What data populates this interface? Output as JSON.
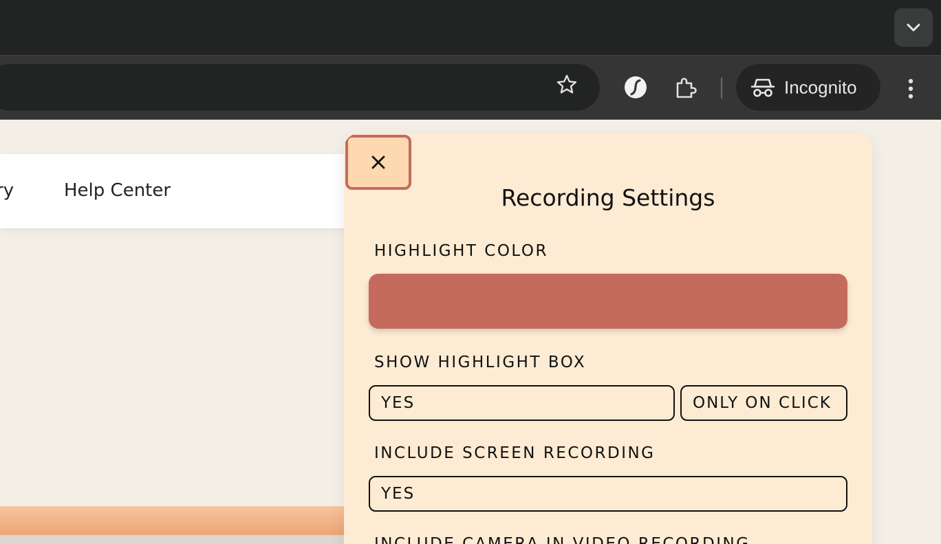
{
  "browser": {
    "incognito_label": "Incognito",
    "icons": {
      "tab_dropdown": "chevron-down-icon",
      "bookmark": "star-icon",
      "extension_one": "coffee-bean-icon",
      "extensions": "puzzle-icon",
      "incognito": "incognito-icon",
      "menu": "vertical-dots-icon"
    }
  },
  "page": {
    "nav_links": [
      "ry",
      "Help Center"
    ]
  },
  "panel": {
    "close_icon": "close-icon",
    "title": "Recording Settings",
    "highlight_color": {
      "label": "HIGHLIGHT COLOR",
      "value": "#c46b5d"
    },
    "show_highlight_box": {
      "label": "SHOW HIGHLIGHT BOX",
      "options": [
        "YES",
        "ONLY ON CLICK"
      ]
    },
    "include_screen_recording": {
      "label": "INCLUDE SCREEN RECORDING",
      "options": [
        "YES"
      ]
    },
    "include_camera": {
      "label": "INCLUDE CAMERA IN VIDEO RECORDING"
    }
  },
  "colors": {
    "panel_bg": "#fdebd3",
    "accent": "#c46b5d",
    "close_bg": "#fed9b0",
    "page_bg": "#f3efe7"
  }
}
